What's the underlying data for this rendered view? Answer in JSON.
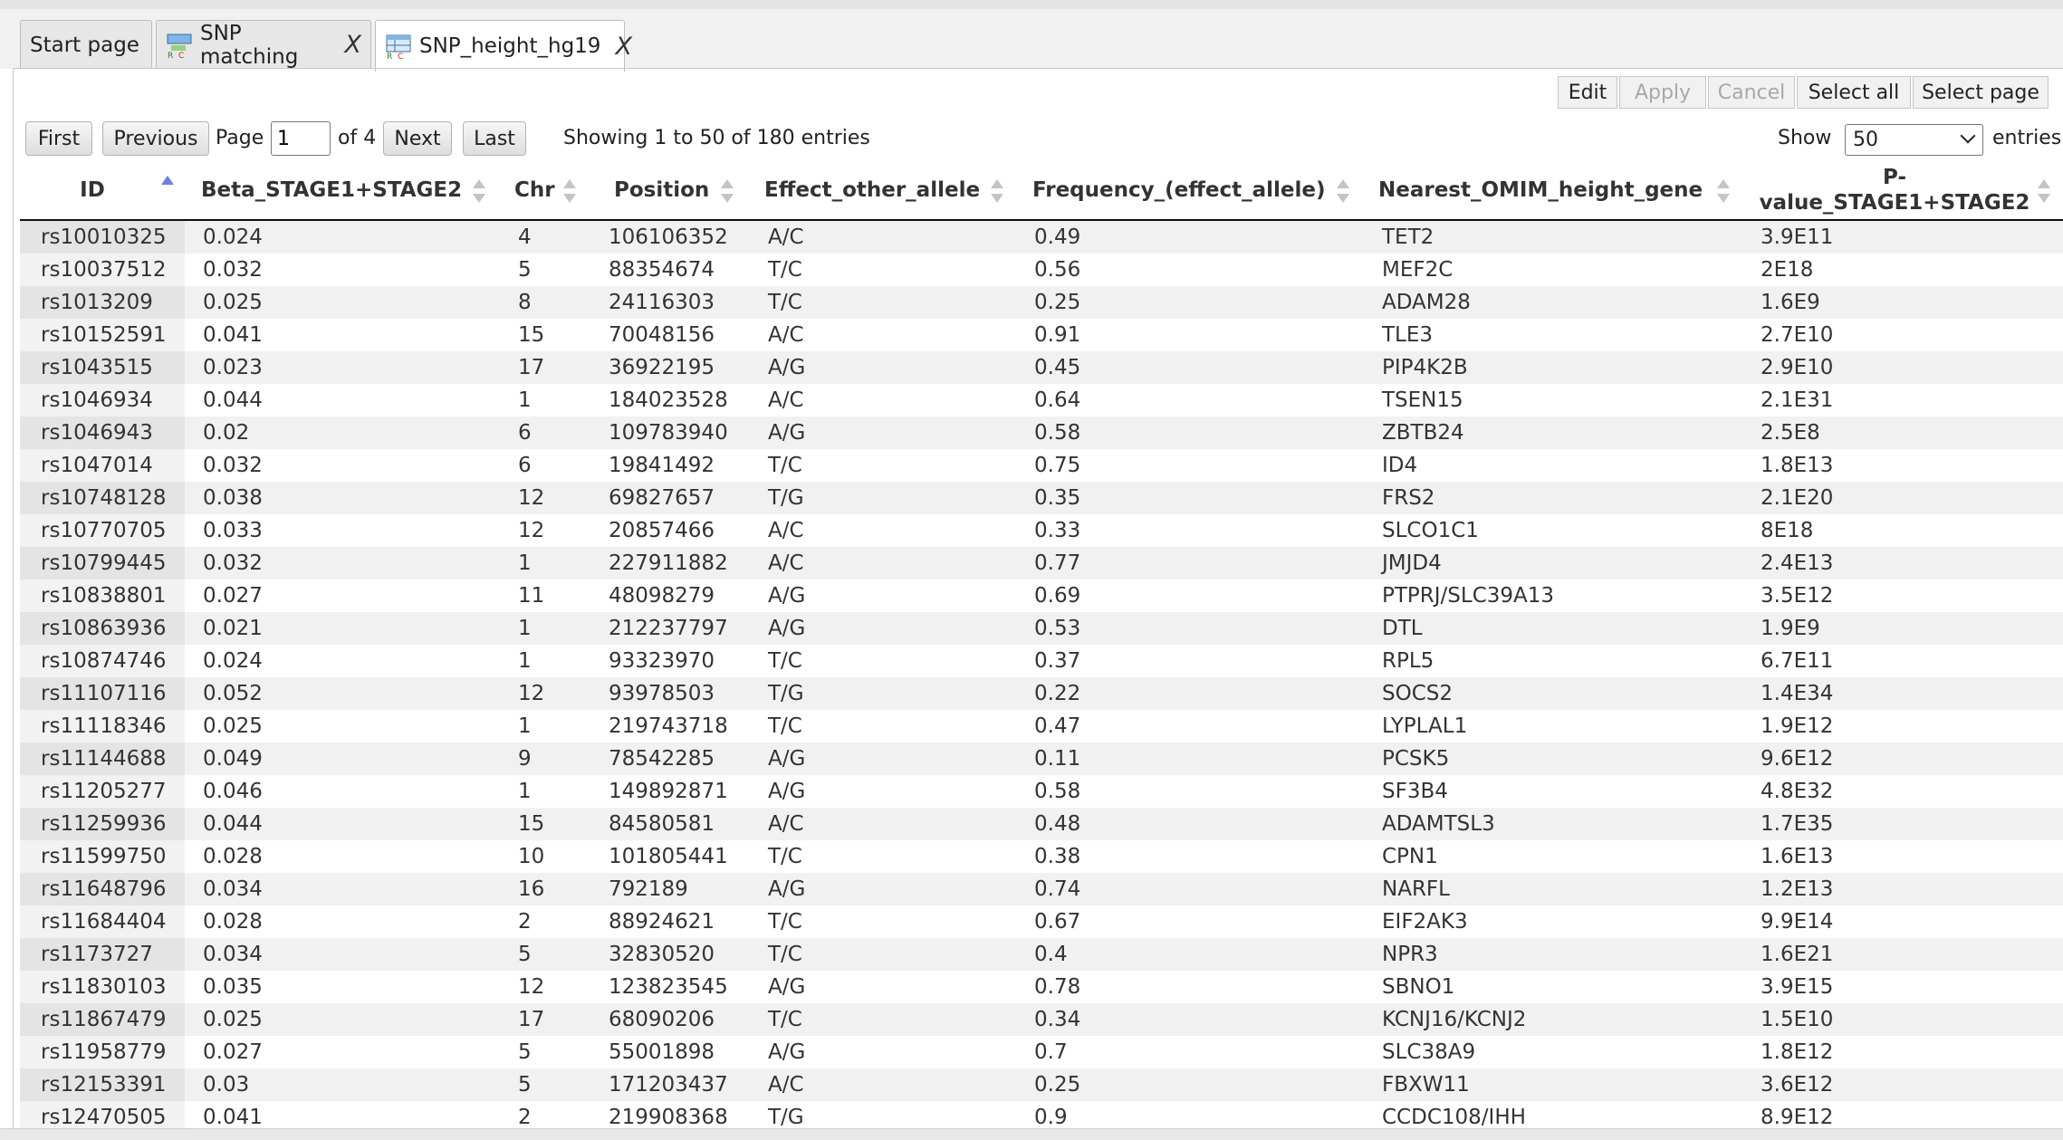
{
  "tabs": [
    {
      "label": "Start page",
      "closable": false
    },
    {
      "label": "SNP matching",
      "closable": true,
      "close": "X"
    },
    {
      "label": "SNP_height_hg19",
      "closable": true,
      "close": "X"
    }
  ],
  "toolbar": {
    "edit": "Edit",
    "apply": "Apply",
    "cancel": "Cancel",
    "select_all": "Select all",
    "select_page": "Select page"
  },
  "paging": {
    "first": "First",
    "previous": "Previous",
    "page_label": "Page",
    "page_value": "1",
    "of_label": "of 4",
    "next": "Next",
    "last": "Last",
    "showing": "Showing 1 to 50 of 180 entries",
    "show_label": "Show",
    "show_value": "50",
    "entries_label": "entries"
  },
  "columns": [
    "ID",
    "Beta_STAGE1+STAGE2",
    "Chr",
    "Position",
    "Effect_other_allele",
    "Frequency_(effect_allele)",
    "Nearest_OMIM_height_gene",
    "P-value_STAGE1+STAGE2"
  ],
  "column_header_lines": {
    "pvalue_line1": "P-",
    "pvalue_line2": "value_STAGE1+STAGE2"
  },
  "sorted_column": "ID",
  "rows": [
    [
      "rs10010325",
      "0.024",
      "4",
      "106106352",
      "A/C",
      "0.49",
      "TET2",
      "3.9E11"
    ],
    [
      "rs10037512",
      "0.032",
      "5",
      "88354674",
      "T/C",
      "0.56",
      "MEF2C",
      "2E18"
    ],
    [
      "rs1013209",
      "0.025",
      "8",
      "24116303",
      "T/C",
      "0.25",
      "ADAM28",
      "1.6E9"
    ],
    [
      "rs10152591",
      "0.041",
      "15",
      "70048156",
      "A/C",
      "0.91",
      "TLE3",
      "2.7E10"
    ],
    [
      "rs1043515",
      "0.023",
      "17",
      "36922195",
      "A/G",
      "0.45",
      "PIP4K2B",
      "2.9E10"
    ],
    [
      "rs1046934",
      "0.044",
      "1",
      "184023528",
      "A/C",
      "0.64",
      "TSEN15",
      "2.1E31"
    ],
    [
      "rs1046943",
      "0.02",
      "6",
      "109783940",
      "A/G",
      "0.58",
      "ZBTB24",
      "2.5E8"
    ],
    [
      "rs1047014",
      "0.032",
      "6",
      "19841492",
      "T/C",
      "0.75",
      "ID4",
      "1.8E13"
    ],
    [
      "rs10748128",
      "0.038",
      "12",
      "69827657",
      "T/G",
      "0.35",
      "FRS2",
      "2.1E20"
    ],
    [
      "rs10770705",
      "0.033",
      "12",
      "20857466",
      "A/C",
      "0.33",
      "SLCO1C1",
      "8E18"
    ],
    [
      "rs10799445",
      "0.032",
      "1",
      "227911882",
      "A/C",
      "0.77",
      "JMJD4",
      "2.4E13"
    ],
    [
      "rs10838801",
      "0.027",
      "11",
      "48098279",
      "A/G",
      "0.69",
      "PTPRJ/SLC39A13",
      "3.5E12"
    ],
    [
      "rs10863936",
      "0.021",
      "1",
      "212237797",
      "A/G",
      "0.53",
      "DTL",
      "1.9E9"
    ],
    [
      "rs10874746",
      "0.024",
      "1",
      "93323970",
      "T/C",
      "0.37",
      "RPL5",
      "6.7E11"
    ],
    [
      "rs11107116",
      "0.052",
      "12",
      "93978503",
      "T/G",
      "0.22",
      "SOCS2",
      "1.4E34"
    ],
    [
      "rs11118346",
      "0.025",
      "1",
      "219743718",
      "T/C",
      "0.47",
      "LYPLAL1",
      "1.9E12"
    ],
    [
      "rs11144688",
      "0.049",
      "9",
      "78542285",
      "A/G",
      "0.11",
      "PCSK5",
      "9.6E12"
    ],
    [
      "rs11205277",
      "0.046",
      "1",
      "149892871",
      "A/G",
      "0.58",
      "SF3B4",
      "4.8E32"
    ],
    [
      "rs11259936",
      "0.044",
      "15",
      "84580581",
      "A/C",
      "0.48",
      "ADAMTSL3",
      "1.7E35"
    ],
    [
      "rs11599750",
      "0.028",
      "10",
      "101805441",
      "T/C",
      "0.38",
      "CPN1",
      "1.6E13"
    ],
    [
      "rs11648796",
      "0.034",
      "16",
      "792189",
      "A/G",
      "0.74",
      "NARFL",
      "1.2E13"
    ],
    [
      "rs11684404",
      "0.028",
      "2",
      "88924621",
      "T/C",
      "0.67",
      "EIF2AK3",
      "9.9E14"
    ],
    [
      "rs1173727",
      "0.034",
      "5",
      "32830520",
      "T/C",
      "0.4",
      "NPR3",
      "1.6E21"
    ],
    [
      "rs11830103",
      "0.035",
      "12",
      "123823545",
      "A/G",
      "0.78",
      "SBNO1",
      "3.9E15"
    ],
    [
      "rs11867479",
      "0.025",
      "17",
      "68090206",
      "T/C",
      "0.34",
      "KCNJ16/KCNJ2",
      "1.5E10"
    ],
    [
      "rs11958779",
      "0.027",
      "5",
      "55001898",
      "A/G",
      "0.7",
      "SLC38A9",
      "1.8E12"
    ],
    [
      "rs12153391",
      "0.03",
      "5",
      "171203437",
      "A/C",
      "0.25",
      "FBXW11",
      "3.6E12"
    ],
    [
      "rs12470505",
      "0.041",
      "2",
      "219908368",
      "T/G",
      "0.9",
      "CCDC108/IHH",
      "8.9E12"
    ]
  ]
}
